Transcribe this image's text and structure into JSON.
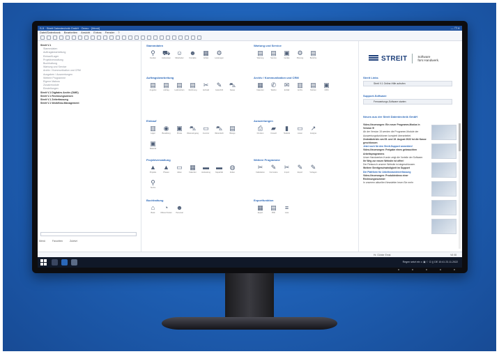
{
  "app": {
    "title": "S-5 · Streit Datentechnik GmbH · Demo · [Menü]",
    "menu": [
      "Datei/Datenbank",
      "Bearbeiten",
      "Ansicht",
      "Extras",
      "Fenster",
      "?"
    ]
  },
  "sidebar": {
    "items": [
      {
        "label": "Streit V.1",
        "bold": true
      },
      {
        "label": "Stammdaten",
        "bold": false
      },
      {
        "label": "Auftragsbearbeitung",
        "bold": false
      },
      {
        "label": "Einkauf/Lager",
        "bold": false
      },
      {
        "label": "Projektverwaltung",
        "bold": false
      },
      {
        "label": "Buchhaltung",
        "bold": false
      },
      {
        "label": "Wartung und Service",
        "bold": false
      },
      {
        "label": "Archiv / Kommunikation und CRM",
        "bold": false
      },
      {
        "label": "Ausgaben / Auswertungen",
        "bold": false
      },
      {
        "label": "Weitere Programme",
        "bold": false
      },
      {
        "label": "Eigene Makros",
        "bold": false
      },
      {
        "label": "Zusatzmodule",
        "bold": false
      },
      {
        "label": "Einstellungen",
        "bold": false
      },
      {
        "label": "Streit V.1 Digitales Archiv (DMS)",
        "bold": true
      },
      {
        "label": "Streit V.1 Rechnungswesen",
        "bold": true
      },
      {
        "label": "Streit V.1 Zeiterfassung",
        "bold": true
      },
      {
        "label": "Streit V.1 Workflow-Management",
        "bold": true
      }
    ],
    "tabs": [
      "Menü",
      "Favoriten",
      "Zuletzt"
    ]
  },
  "sections": [
    {
      "title": "Stammdaten",
      "items": [
        {
          "icon": "person-icon",
          "glyph": "⚲",
          "label": "Kunden"
        },
        {
          "icon": "truck-icon",
          "glyph": "⛟",
          "label": "Lieferanten"
        },
        {
          "icon": "contacts-icon",
          "glyph": "☺",
          "label": "Mitarbeiter"
        },
        {
          "icon": "people-icon",
          "glyph": "☻",
          "label": "Kontakte"
        },
        {
          "icon": "articles-icon",
          "glyph": "▦",
          "label": "Artikel"
        },
        {
          "icon": "gear-icon",
          "glyph": "⚙",
          "label": "Leistungen"
        }
      ]
    },
    {
      "title": "Auftragsbearbeitung",
      "items": [
        {
          "icon": "offer-icon",
          "glyph": "▤",
          "label": "Angebot"
        },
        {
          "icon": "order-icon",
          "glyph": "▤",
          "label": "Auftrag"
        },
        {
          "icon": "delivery-icon",
          "glyph": "▤",
          "label": "Lieferschein"
        },
        {
          "icon": "invoice-icon",
          "glyph": "▤",
          "label": "Rechnung"
        },
        {
          "icon": "tools-icon",
          "glyph": "✂",
          "label": "Aufmaß"
        },
        {
          "icon": "wrench-icon",
          "glyph": "✎",
          "label": "Gutschrift"
        },
        {
          "icon": "cart-icon",
          "glyph": "⛍",
          "label": "Kasse"
        }
      ]
    },
    {
      "title": "Einkauf",
      "items": [
        {
          "icon": "stock-icon",
          "glyph": "▥",
          "label": "Lager"
        },
        {
          "icon": "order-out-icon",
          "glyph": "◉",
          "label": "Bestellung"
        },
        {
          "icon": "price-icon",
          "glyph": "▣",
          "label": "Preise"
        },
        {
          "icon": "cart-in-icon",
          "glyph": "⛍",
          "label": "Wareneingang"
        },
        {
          "icon": "inventory-icon",
          "glyph": "▭",
          "label": "Inventur"
        },
        {
          "icon": "basket-icon",
          "glyph": "⛍",
          "label": "Warenkorb"
        },
        {
          "icon": "doc-icon",
          "glyph": "▤",
          "label": "Belege"
        },
        {
          "icon": "material-icon",
          "glyph": "▣",
          "label": "Material"
        }
      ]
    },
    {
      "title": "Projektverwaltung",
      "items": [
        {
          "icon": "project-icon",
          "glyph": "▲",
          "label": "Projekte"
        },
        {
          "icon": "phase-icon",
          "glyph": "▲",
          "label": "Phasen"
        },
        {
          "icon": "folder-icon",
          "glyph": "▭",
          "label": "Akten"
        },
        {
          "icon": "calendar-icon",
          "glyph": "▦",
          "label": "Kalender"
        },
        {
          "icon": "workload-icon",
          "glyph": "▬",
          "label": "Auslastung"
        },
        {
          "icon": "capacity-icon",
          "glyph": "▬",
          "label": "Kapazität"
        },
        {
          "icon": "timer-icon",
          "glyph": "◍",
          "label": "Zeiten"
        },
        {
          "icon": "search-icon",
          "glyph": "⚲",
          "label": "Suche"
        }
      ]
    },
    {
      "title": "Buchhaltung",
      "items": [
        {
          "icon": "bank-icon",
          "glyph": "⌂",
          "label": "Bank"
        },
        {
          "icon": "clock-icon",
          "glyph": "◔",
          "label": "Offene Posten"
        },
        {
          "icon": "people-icon",
          "glyph": "☻",
          "label": "Personal"
        }
      ]
    },
    {
      "title": "Wartung und Service",
      "items": [
        {
          "icon": "contract-icon",
          "glyph": "▤",
          "label": "Wartung"
        },
        {
          "icon": "service-icon",
          "glyph": "▤",
          "label": "Service"
        },
        {
          "icon": "device-icon",
          "glyph": "▣",
          "label": "Geräte"
        },
        {
          "icon": "plan-icon",
          "glyph": "⚙",
          "label": "Planung"
        },
        {
          "icon": "report-icon",
          "glyph": "▤",
          "label": "Berichte"
        }
      ]
    },
    {
      "title": "Archiv / Kommunikation und CRM",
      "items": [
        {
          "icon": "calendar-icon",
          "glyph": "▦",
          "label": "Kalender"
        },
        {
          "icon": "phone-icon",
          "glyph": "✆",
          "label": "Telefon"
        },
        {
          "icon": "mail-icon",
          "glyph": "✉",
          "label": "E-Mail"
        },
        {
          "icon": "archive-icon",
          "glyph": "▥",
          "label": "Archiv"
        },
        {
          "icon": "notes-icon",
          "glyph": "▤",
          "label": "Notizen"
        },
        {
          "icon": "crm-icon",
          "glyph": "▣",
          "label": "CRM"
        }
      ]
    },
    {
      "title": "Auswertungen",
      "items": [
        {
          "icon": "printer-icon",
          "glyph": "⎙",
          "label": "Drucken"
        },
        {
          "icon": "chart-line-icon",
          "glyph": "▰",
          "label": "Umsatz"
        },
        {
          "icon": "chart-bar-icon",
          "glyph": "▮",
          "label": "Statistik"
        },
        {
          "icon": "sheet-icon",
          "glyph": "▭",
          "label": "Listen"
        },
        {
          "icon": "trend-icon",
          "glyph": "↗",
          "label": "Analyse"
        }
      ]
    },
    {
      "title": "Weitere Programme",
      "items": [
        {
          "icon": "tool-a-icon",
          "glyph": "✂",
          "label": "Kalkulation"
        },
        {
          "icon": "tool-b-icon",
          "glyph": "✎",
          "label": "Formulare"
        },
        {
          "icon": "tool-c-icon",
          "glyph": "✂",
          "label": "Import"
        },
        {
          "icon": "tool-d-icon",
          "glyph": "✎",
          "label": "Export"
        },
        {
          "icon": "tool-e-icon",
          "glyph": "✎",
          "label": "Vorlagen"
        }
      ]
    },
    {
      "title": "Exportfunktion",
      "items": [
        {
          "icon": "export-csv-icon",
          "glyph": "▦",
          "label": "Export"
        },
        {
          "icon": "export-pdf-icon",
          "glyph": "▤",
          "label": "PDF"
        },
        {
          "icon": "export-list-icon",
          "glyph": "≡",
          "label": "Liste"
        }
      ]
    }
  ],
  "right": {
    "logo": "STREIT",
    "logo_sub1": "Software",
    "logo_sub2": "fürs Handwerk.",
    "links_title": "Streit Links",
    "link_button": "Streit V.1 Online-Hilfe aufrufen",
    "support_title": "Support-Software",
    "support_button": "Fernwartungs-Software starten",
    "news_title": "Neues aus der Streit Datentechnik GmbH",
    "news": [
      {
        "text": "Video-Neuerungen: Ein neuer Programm-Modus in Version 5!",
        "style": "ttl"
      },
      {
        "text": "Ab der Version 15 werden die Programm-Module der Auswertungsfunktionen komplett überarbeitet.",
        "style": ""
      },
      {
        "text": "Zentralbetrieb: am 05. und 19. August 2022 ist die Kasse geschlossen",
        "style": "ttl"
      },
      {
        "text": "Jetzt noch für den Streit-Support anmelden!",
        "style": "hl"
      },
      {
        "text": "Video-Neuerungen: Freigabe eines gebrauchten Arbeitsprogramms",
        "style": "ttl"
      },
      {
        "text": "Unser Handwerker-Kunde zeigt die Vorteile der Software.",
        "style": ""
      },
      {
        "text": "Ihr Weg zur neuen Website ist offen!",
        "style": "ttl"
      },
      {
        "text": "Der Relaunch unserer Website ist abgeschlossen.",
        "style": ""
      },
      {
        "text": "Weitere Streitgeschwindigkeit im Support",
        "style": "ttl"
      },
      {
        "text": "Die Plattform für Arbeitsstundenerfassung",
        "style": "hl"
      },
      {
        "text": "Video-Neuerungen: Produktvideos einer Rechnungsnummer",
        "style": "ttl"
      },
      {
        "text": "In unserem aktuellen Newsletter lesen Sie mehr",
        "style": ""
      }
    ]
  },
  "status": {
    "user": "Hr. Günter Ernst",
    "version": "V6 08"
  },
  "taskbar": {
    "tray": "Regen setzt ein   ∧  ▣  ⚐  ⊡  ))  DE   10:41   23.11.2022"
  }
}
